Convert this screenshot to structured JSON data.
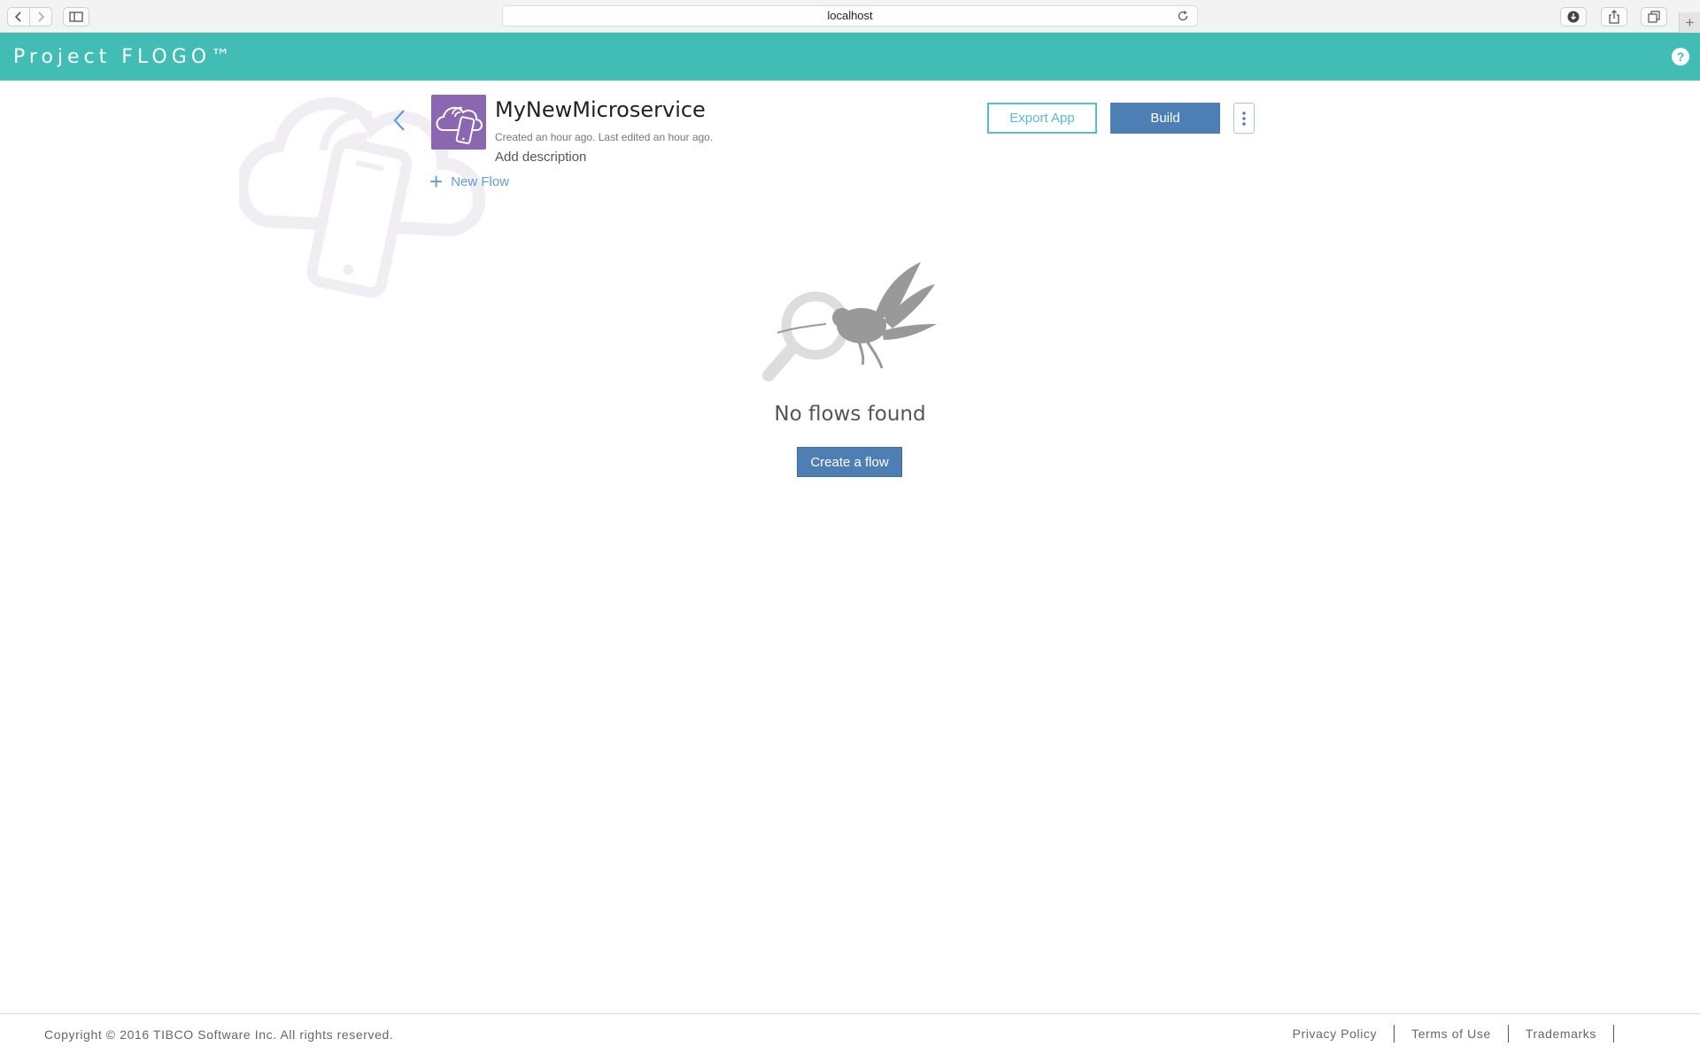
{
  "browser": {
    "address": "localhost"
  },
  "header": {
    "brand": "Project FLOGO™",
    "help_label": "?"
  },
  "app": {
    "title": "MyNewMicroservice",
    "meta": "Created an hour ago. Last edited an hour ago.",
    "add_description": "Add description",
    "new_flow_label": "New Flow",
    "export_label": "Export App",
    "build_label": "Build"
  },
  "empty_state": {
    "message": "No flows found",
    "create_label": "Create a flow"
  },
  "footer": {
    "copyright": "Copyright © 2016 TIBCO Software Inc. All rights reserved.",
    "links": [
      "Privacy Policy",
      "Terms of Use",
      "Trademarks"
    ]
  },
  "colors": {
    "header_bg": "#41bdb6",
    "primary_button": "#4d7fb4",
    "outline_button": "#57bdd1",
    "app_icon_bg": "#8a67b0",
    "link": "#5a9fd2"
  }
}
